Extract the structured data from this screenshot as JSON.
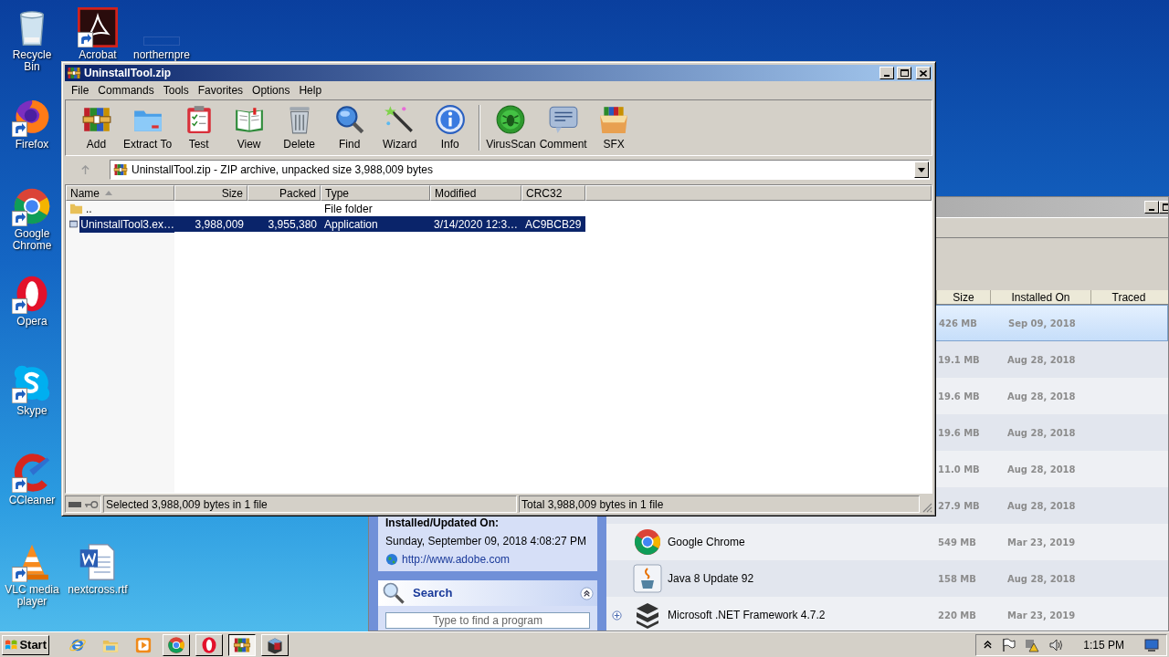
{
  "desktop_icons": [
    {
      "label": "Recycle Bin",
      "kind": "recycle",
      "shortcut": false
    },
    {
      "label": "Acrobat",
      "kind": "acrobat",
      "shortcut": true
    },
    {
      "label": "northernpre",
      "kind": "blank",
      "shortcut": false
    },
    {
      "label": "Firefox",
      "kind": "firefox",
      "shortcut": true
    },
    {
      "label": "Google Chrome",
      "kind": "chrome",
      "shortcut": true
    },
    {
      "label": "Opera",
      "kind": "opera",
      "shortcut": true
    },
    {
      "label": "Skype",
      "kind": "skype",
      "shortcut": true
    },
    {
      "label": "CCleaner",
      "kind": "ccleaner",
      "shortcut": true
    },
    {
      "label": "VLC media player",
      "kind": "vlc",
      "shortcut": true
    },
    {
      "label": "nextcross.rtf",
      "kind": "word",
      "shortcut": false
    }
  ],
  "uninstaller": {
    "columns": [
      "Size",
      "Installed On",
      "Traced"
    ],
    "rows": [
      {
        "size": "426 MB",
        "date": "Sep 09, 2018",
        "selected": true
      },
      {
        "size": "19.1 MB",
        "date": "Aug 28, 2018",
        "selected": false
      },
      {
        "size": "19.6 MB",
        "date": "Aug 28, 2018",
        "selected": false
      },
      {
        "size": "19.6 MB",
        "date": "Aug 28, 2018",
        "selected": false
      },
      {
        "size": "11.0 MB",
        "date": "Aug 28, 2018",
        "selected": false
      },
      {
        "size": "27.9 MB",
        "date": "Aug 28, 2018",
        "selected": false
      },
      {
        "name": "Google Chrome",
        "kind": "chrome",
        "size": "549 MB",
        "date": "Mar 23, 2019",
        "selected": false
      },
      {
        "name": "Java 8 Update 92",
        "kind": "java",
        "size": "158 MB",
        "date": "Aug 28, 2018",
        "selected": false
      },
      {
        "name": "Microsoft .NET Framework 4.7.2",
        "kind": "dotnet",
        "expandable": true,
        "size": "220 MB",
        "date": "Mar 23, 2019",
        "selected": false
      }
    ],
    "details": {
      "heading": "Installed/Updated On:",
      "date": "Sunday, September 09, 2018 4:08:27 PM",
      "link": "http://www.adobe.com"
    },
    "search": {
      "title": "Search",
      "placeholder": "Type to find a program"
    }
  },
  "winrar": {
    "title": "UninstallTool.zip",
    "menu": [
      "File",
      "Commands",
      "Tools",
      "Favorites",
      "Options",
      "Help"
    ],
    "toolbar": [
      {
        "label": "Add",
        "kind": "add"
      },
      {
        "label": "Extract To",
        "kind": "extract"
      },
      {
        "label": "Test",
        "kind": "test"
      },
      {
        "label": "View",
        "kind": "view"
      },
      {
        "label": "Delete",
        "kind": "delete"
      },
      {
        "label": "Find",
        "kind": "find"
      },
      {
        "label": "Wizard",
        "kind": "wizard"
      },
      {
        "label": "Info",
        "kind": "info"
      },
      {
        "label": "VirusScan",
        "kind": "virus"
      },
      {
        "label": "Comment",
        "kind": "comment"
      },
      {
        "label": "SFX",
        "kind": "sfx"
      }
    ],
    "address": "UninstallTool.zip - ZIP archive, unpacked size 3,988,009 bytes",
    "columns": [
      {
        "label": "Name",
        "sorted": true
      },
      {
        "label": "Size",
        "sorted": false
      },
      {
        "label": "Packed",
        "sorted": false
      },
      {
        "label": "Type",
        "sorted": false
      },
      {
        "label": "Modified",
        "sorted": false
      },
      {
        "label": "CRC32",
        "sorted": false
      }
    ],
    "rows": [
      {
        "kind": "folder",
        "cells": [
          "..",
          "",
          "",
          "File folder",
          "",
          ""
        ],
        "selected": false
      },
      {
        "kind": "exe",
        "cells": [
          "UninstallTool3.ex…",
          "3,988,009",
          "3,955,380",
          "Application",
          "3/14/2020 12:3…",
          "AC9BCB29"
        ],
        "selected": true
      }
    ],
    "status_left": "Selected 3,988,009 bytes in 1 file",
    "status_right": "Total 3,988,009 bytes in 1 file"
  },
  "taskbar": {
    "start": "Start",
    "apps": [
      {
        "kind": "ie",
        "selected": false
      },
      {
        "kind": "explorer",
        "selected": false
      },
      {
        "kind": "media",
        "selected": false
      },
      {
        "kind": "chrome",
        "selected": false
      },
      {
        "kind": "opera",
        "selected": false
      },
      {
        "kind": "add",
        "selected": true
      },
      {
        "kind": "installer",
        "selected": false
      }
    ],
    "clock": "1:15 PM"
  }
}
